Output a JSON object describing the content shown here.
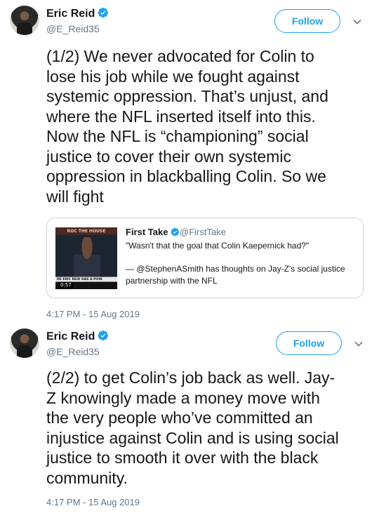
{
  "tweets": [
    {
      "author": {
        "name": "Eric Reid",
        "handle": "@E_Reid35",
        "verified": true
      },
      "follow_label": "Follow",
      "text": "(1/2) We never advocated for Colin to\nlose his job while we fought against\nsystemic oppression. That’s unjust, and\nwhere the NFL inserted itself into this.\nNow the NFL is “championing” social\njustice to cover their own systemic\noppression in blackballing Colin. So we\nwill fight",
      "quote": {
        "name": "First Take",
        "handle": "@FirstTake",
        "verified": true,
        "quote_line": "\"Wasn't that the goal that Colin Kaepernick had?\"",
        "description": "— @StephenASmith has thoughts on Jay-Z's social justice\npartnership with the NFL",
        "thumb_banner": "ROC THE HOUSE",
        "thumb_caption": "DE ERIC REID HAS A POIN",
        "thumb_duration": "0:57"
      },
      "timestamp": "4:17 PM - 15 Aug 2019"
    },
    {
      "author": {
        "name": "Eric Reid",
        "handle": "@E_Reid35",
        "verified": true
      },
      "follow_label": "Follow",
      "text": "(2/2) to get Colin’s job back as well. Jay-\nZ knowingly made a money move with\nthe very people who’ve committed an\ninjustice against Colin and is using social\njustice to smooth it over with the black\ncommunity.",
      "timestamp": "4:17 PM - 15 Aug 2019"
    }
  ],
  "colors": {
    "accent": "#1da1f2",
    "secondary_text": "#657786",
    "border": "#ccd6dd"
  }
}
